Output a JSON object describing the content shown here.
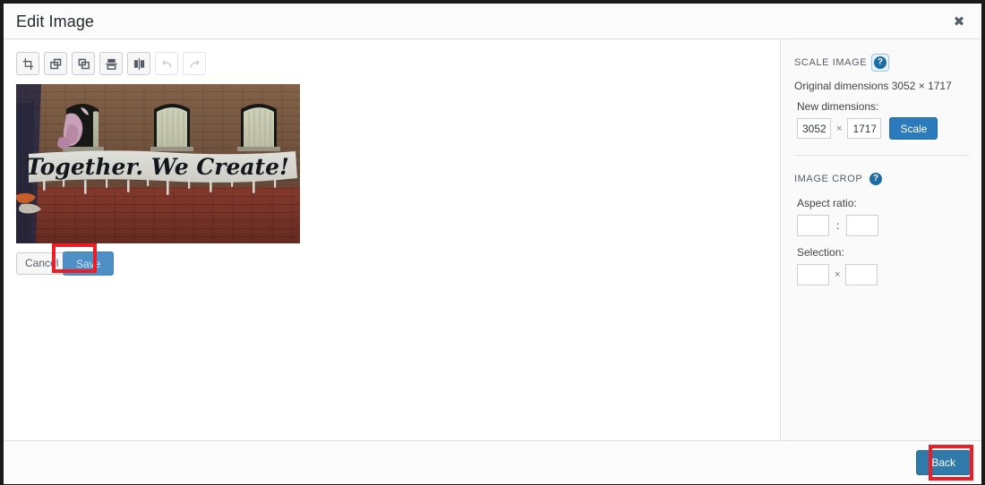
{
  "window": {
    "title": "Edit Image",
    "close_icon": "close-icon",
    "close_label": "✖"
  },
  "toolbar": {
    "items": [
      {
        "name": "crop",
        "label": "Crop",
        "icon": "crop-icon",
        "disabled": false
      },
      {
        "name": "rotate-left",
        "label": "Rotate left",
        "icon": "rotate-left-icon",
        "disabled": false
      },
      {
        "name": "rotate-right",
        "label": "Rotate right",
        "icon": "rotate-right-icon",
        "disabled": false
      },
      {
        "name": "flip-vertical",
        "label": "Flip vertical",
        "icon": "flip-vertical-icon",
        "disabled": false
      },
      {
        "name": "flip-horizontal",
        "label": "Flip horizontal",
        "icon": "flip-horizontal-icon",
        "disabled": false
      },
      {
        "name": "undo",
        "label": "Undo",
        "icon": "undo-icon",
        "disabled": true
      },
      {
        "name": "redo",
        "label": "Redo",
        "icon": "redo-icon",
        "disabled": true
      }
    ]
  },
  "preview": {
    "alt": "Brick wall mural reading Together. We Create!",
    "mural_text": "Together. We Create!"
  },
  "edit_actions": {
    "cancel_label": "Cancel",
    "save_label": "Save"
  },
  "scale_image": {
    "heading": "SCALE IMAGE",
    "help_label": "?",
    "original_dimensions_text": "Original dimensions 3052 × 1717",
    "original_width": 3052,
    "original_height": 1717,
    "new_dimensions_label": "New dimensions:",
    "new_width": "3052",
    "new_height": "1717",
    "separator": "×",
    "scale_button_label": "Scale"
  },
  "image_crop": {
    "heading": "IMAGE CROP",
    "help_label": "?",
    "aspect_ratio_label": "Aspect ratio:",
    "aspect_ratio_width": "",
    "aspect_ratio_height": "",
    "aspect_separator": ":",
    "selection_label": "Selection:",
    "selection_width": "",
    "selection_height": "",
    "selection_separator": "×"
  },
  "footer": {
    "back_label": "Back"
  },
  "annotations": {
    "color": "#ee1c25",
    "boxes": [
      {
        "target": "save-button"
      },
      {
        "target": "back-button"
      }
    ]
  }
}
